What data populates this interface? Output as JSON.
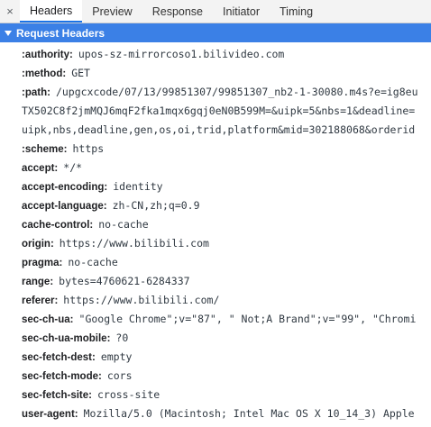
{
  "tabs": {
    "close": "×",
    "items": [
      "Headers",
      "Preview",
      "Response",
      "Initiator",
      "Timing"
    ]
  },
  "section": {
    "title": "Request Headers"
  },
  "headers": [
    {
      "name": ":authority:",
      "value": "upos-sz-mirrorcoso1.bilivideo.com"
    },
    {
      "name": ":method:",
      "value": "GET"
    },
    {
      "name": ":path:",
      "value": "/upgcxcode/07/13/99851307/99851307_nb2-1-30080.m4s?e=ig8eu",
      "cont1": "TX502C8f2jmMQJ6mqF2fka1mqx6gqj0eN0B599M=&uipk=5&nbs=1&deadline=",
      "cont2": "uipk,nbs,deadline,gen,os,oi,trid,platform&mid=302188068&orderid"
    },
    {
      "name": ":scheme:",
      "value": "https"
    },
    {
      "name": "accept:",
      "value": "*/*"
    },
    {
      "name": "accept-encoding:",
      "value": "identity"
    },
    {
      "name": "accept-language:",
      "value": "zh-CN,zh;q=0.9"
    },
    {
      "name": "cache-control:",
      "value": "no-cache"
    },
    {
      "name": "origin:",
      "value": "https://www.bilibili.com"
    },
    {
      "name": "pragma:",
      "value": "no-cache"
    },
    {
      "name": "range:",
      "value": "bytes=4760621-6284337"
    },
    {
      "name": "referer:",
      "value": "https://www.bilibili.com/"
    },
    {
      "name": "sec-ch-ua:",
      "value": "\"Google Chrome\";v=\"87\", \" Not;A Brand\";v=\"99\", \"Chromi"
    },
    {
      "name": "sec-ch-ua-mobile:",
      "value": "?0"
    },
    {
      "name": "sec-fetch-dest:",
      "value": "empty"
    },
    {
      "name": "sec-fetch-mode:",
      "value": "cors"
    },
    {
      "name": "sec-fetch-site:",
      "value": "cross-site"
    },
    {
      "name": "user-agent:",
      "value": "Mozilla/5.0 (Macintosh; Intel Mac OS X 10_14_3) Apple"
    }
  ]
}
